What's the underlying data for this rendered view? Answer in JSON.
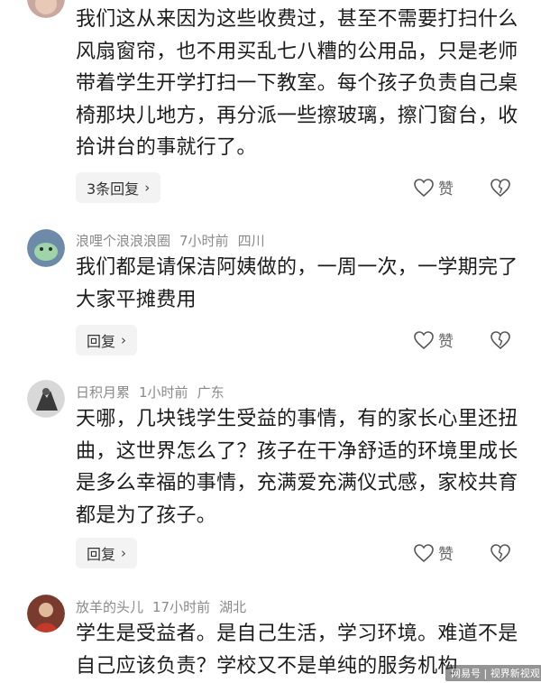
{
  "comments": [
    {
      "name": "",
      "time": "",
      "location": "",
      "body": "我们这从来因为这些收费过，甚至不需要打扫什么风扇窗帘，也不用买乱七八糟的公用品，只是老师带着学生开学打扫一下教室。每个孩子负责自己桌椅那块儿地方，再分派一些擦玻璃，擦门窗台，收拾讲台的事就行了。",
      "reply_label": "3条回复",
      "like_label": "赞"
    },
    {
      "name": "浪哩个浪浪浪圈",
      "time": "7小时前",
      "location": "四川",
      "body": "我们都是请保洁阿姨做的，一周一次，一学期完了大家平摊费用",
      "reply_label": "回复",
      "like_label": "赞"
    },
    {
      "name": "日积月累",
      "time": "1小时前",
      "location": "广东",
      "body": "天哪，几块钱学生受益的事情，有的家长心里还扭曲，这世界怎么了？孩子在干净舒适的环境里成长是多么幸福的事情，充满爱充满仪式感，家校共育都是为了孩子。",
      "reply_label": "回复",
      "like_label": "赞"
    },
    {
      "name": "放羊的头儿",
      "time": "17小时前",
      "location": "湖北",
      "body": "学生是受益者。是自己生活，学习环境。难道不是自己应该负责？学校又不是单纯的服务机构",
      "reply_label": "",
      "like_label": ""
    }
  ],
  "watermark": "网易号 | 视界新视观",
  "icons": {
    "like": "heart-outline-icon",
    "dislike": "broken-heart-icon",
    "chevron": "chevron-right-icon"
  },
  "colors": {
    "meta": "#8a8a8a",
    "body": "#1c1c1c",
    "button_bg": "#f3f3f3"
  }
}
